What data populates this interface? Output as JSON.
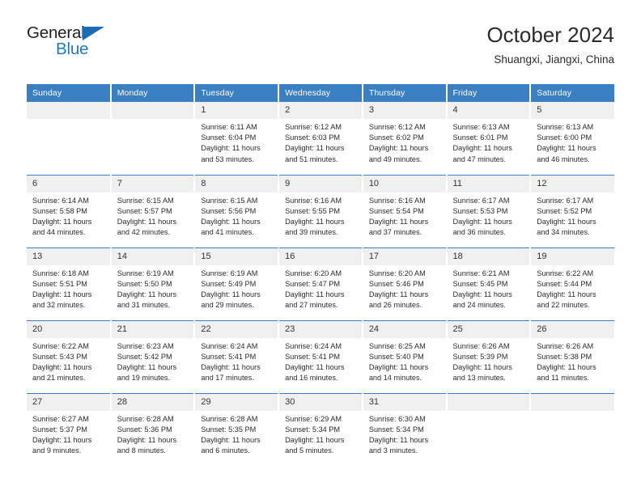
{
  "brand": {
    "name_top": "General",
    "name_bottom": "Blue",
    "triangle_color": "#1b6cb5",
    "text_color": "#231f20",
    "blue_color": "#1f7ac0"
  },
  "header": {
    "title": "October 2024",
    "subtitle": "Shuangxi, Jiangxi, China"
  },
  "theme": {
    "header_row_bg": "#3a7fc1",
    "header_row_text": "#ffffff",
    "daynum_bg": "#f0f0f0",
    "grid_line": "#3a7fc1",
    "page_bg": "#ffffff"
  },
  "weekday_headers": [
    "Sunday",
    "Monday",
    "Tuesday",
    "Wednesday",
    "Thursday",
    "Friday",
    "Saturday"
  ],
  "labels": {
    "sunrise_prefix": "Sunrise:",
    "sunset_prefix": "Sunset:",
    "daylight_prefix": "Daylight:"
  },
  "weeks": [
    [
      {
        "day": "",
        "blank": true,
        "line1": "",
        "line2": "",
        "line3": "",
        "line4": ""
      },
      {
        "day": "",
        "blank": true,
        "line1": "",
        "line2": "",
        "line3": "",
        "line4": ""
      },
      {
        "day": "1",
        "blank": false,
        "line1": "Sunrise: 6:11 AM",
        "line2": "Sunset: 6:04 PM",
        "line3": "Daylight: 11 hours",
        "line4": "and 53 minutes."
      },
      {
        "day": "2",
        "blank": false,
        "line1": "Sunrise: 6:12 AM",
        "line2": "Sunset: 6:03 PM",
        "line3": "Daylight: 11 hours",
        "line4": "and 51 minutes."
      },
      {
        "day": "3",
        "blank": false,
        "line1": "Sunrise: 6:12 AM",
        "line2": "Sunset: 6:02 PM",
        "line3": "Daylight: 11 hours",
        "line4": "and 49 minutes."
      },
      {
        "day": "4",
        "blank": false,
        "line1": "Sunrise: 6:13 AM",
        "line2": "Sunset: 6:01 PM",
        "line3": "Daylight: 11 hours",
        "line4": "and 47 minutes."
      },
      {
        "day": "5",
        "blank": false,
        "line1": "Sunrise: 6:13 AM",
        "line2": "Sunset: 6:00 PM",
        "line3": "Daylight: 11 hours",
        "line4": "and 46 minutes."
      }
    ],
    [
      {
        "day": "6",
        "blank": false,
        "line1": "Sunrise: 6:14 AM",
        "line2": "Sunset: 5:58 PM",
        "line3": "Daylight: 11 hours",
        "line4": "and 44 minutes."
      },
      {
        "day": "7",
        "blank": false,
        "line1": "Sunrise: 6:15 AM",
        "line2": "Sunset: 5:57 PM",
        "line3": "Daylight: 11 hours",
        "line4": "and 42 minutes."
      },
      {
        "day": "8",
        "blank": false,
        "line1": "Sunrise: 6:15 AM",
        "line2": "Sunset: 5:56 PM",
        "line3": "Daylight: 11 hours",
        "line4": "and 41 minutes."
      },
      {
        "day": "9",
        "blank": false,
        "line1": "Sunrise: 6:16 AM",
        "line2": "Sunset: 5:55 PM",
        "line3": "Daylight: 11 hours",
        "line4": "and 39 minutes."
      },
      {
        "day": "10",
        "blank": false,
        "line1": "Sunrise: 6:16 AM",
        "line2": "Sunset: 5:54 PM",
        "line3": "Daylight: 11 hours",
        "line4": "and 37 minutes."
      },
      {
        "day": "11",
        "blank": false,
        "line1": "Sunrise: 6:17 AM",
        "line2": "Sunset: 5:53 PM",
        "line3": "Daylight: 11 hours",
        "line4": "and 36 minutes."
      },
      {
        "day": "12",
        "blank": false,
        "line1": "Sunrise: 6:17 AM",
        "line2": "Sunset: 5:52 PM",
        "line3": "Daylight: 11 hours",
        "line4": "and 34 minutes."
      }
    ],
    [
      {
        "day": "13",
        "blank": false,
        "line1": "Sunrise: 6:18 AM",
        "line2": "Sunset: 5:51 PM",
        "line3": "Daylight: 11 hours",
        "line4": "and 32 minutes."
      },
      {
        "day": "14",
        "blank": false,
        "line1": "Sunrise: 6:19 AM",
        "line2": "Sunset: 5:50 PM",
        "line3": "Daylight: 11 hours",
        "line4": "and 31 minutes."
      },
      {
        "day": "15",
        "blank": false,
        "line1": "Sunrise: 6:19 AM",
        "line2": "Sunset: 5:49 PM",
        "line3": "Daylight: 11 hours",
        "line4": "and 29 minutes."
      },
      {
        "day": "16",
        "blank": false,
        "line1": "Sunrise: 6:20 AM",
        "line2": "Sunset: 5:47 PM",
        "line3": "Daylight: 11 hours",
        "line4": "and 27 minutes."
      },
      {
        "day": "17",
        "blank": false,
        "line1": "Sunrise: 6:20 AM",
        "line2": "Sunset: 5:46 PM",
        "line3": "Daylight: 11 hours",
        "line4": "and 26 minutes."
      },
      {
        "day": "18",
        "blank": false,
        "line1": "Sunrise: 6:21 AM",
        "line2": "Sunset: 5:45 PM",
        "line3": "Daylight: 11 hours",
        "line4": "and 24 minutes."
      },
      {
        "day": "19",
        "blank": false,
        "line1": "Sunrise: 6:22 AM",
        "line2": "Sunset: 5:44 PM",
        "line3": "Daylight: 11 hours",
        "line4": "and 22 minutes."
      }
    ],
    [
      {
        "day": "20",
        "blank": false,
        "line1": "Sunrise: 6:22 AM",
        "line2": "Sunset: 5:43 PM",
        "line3": "Daylight: 11 hours",
        "line4": "and 21 minutes."
      },
      {
        "day": "21",
        "blank": false,
        "line1": "Sunrise: 6:23 AM",
        "line2": "Sunset: 5:42 PM",
        "line3": "Daylight: 11 hours",
        "line4": "and 19 minutes."
      },
      {
        "day": "22",
        "blank": false,
        "line1": "Sunrise: 6:24 AM",
        "line2": "Sunset: 5:41 PM",
        "line3": "Daylight: 11 hours",
        "line4": "and 17 minutes."
      },
      {
        "day": "23",
        "blank": false,
        "line1": "Sunrise: 6:24 AM",
        "line2": "Sunset: 5:41 PM",
        "line3": "Daylight: 11 hours",
        "line4": "and 16 minutes."
      },
      {
        "day": "24",
        "blank": false,
        "line1": "Sunrise: 6:25 AM",
        "line2": "Sunset: 5:40 PM",
        "line3": "Daylight: 11 hours",
        "line4": "and 14 minutes."
      },
      {
        "day": "25",
        "blank": false,
        "line1": "Sunrise: 6:26 AM",
        "line2": "Sunset: 5:39 PM",
        "line3": "Daylight: 11 hours",
        "line4": "and 13 minutes."
      },
      {
        "day": "26",
        "blank": false,
        "line1": "Sunrise: 6:26 AM",
        "line2": "Sunset: 5:38 PM",
        "line3": "Daylight: 11 hours",
        "line4": "and 11 minutes."
      }
    ],
    [
      {
        "day": "27",
        "blank": false,
        "line1": "Sunrise: 6:27 AM",
        "line2": "Sunset: 5:37 PM",
        "line3": "Daylight: 11 hours",
        "line4": "and 9 minutes."
      },
      {
        "day": "28",
        "blank": false,
        "line1": "Sunrise: 6:28 AM",
        "line2": "Sunset: 5:36 PM",
        "line3": "Daylight: 11 hours",
        "line4": "and 8 minutes."
      },
      {
        "day": "29",
        "blank": false,
        "line1": "Sunrise: 6:28 AM",
        "line2": "Sunset: 5:35 PM",
        "line3": "Daylight: 11 hours",
        "line4": "and 6 minutes."
      },
      {
        "day": "30",
        "blank": false,
        "line1": "Sunrise: 6:29 AM",
        "line2": "Sunset: 5:34 PM",
        "line3": "Daylight: 11 hours",
        "line4": "and 5 minutes."
      },
      {
        "day": "31",
        "blank": false,
        "line1": "Sunrise: 6:30 AM",
        "line2": "Sunset: 5:34 PM",
        "line3": "Daylight: 11 hours",
        "line4": "and 3 minutes."
      },
      {
        "day": "",
        "blank": true,
        "line1": "",
        "line2": "",
        "line3": "",
        "line4": ""
      },
      {
        "day": "",
        "blank": true,
        "line1": "",
        "line2": "",
        "line3": "",
        "line4": ""
      }
    ]
  ]
}
